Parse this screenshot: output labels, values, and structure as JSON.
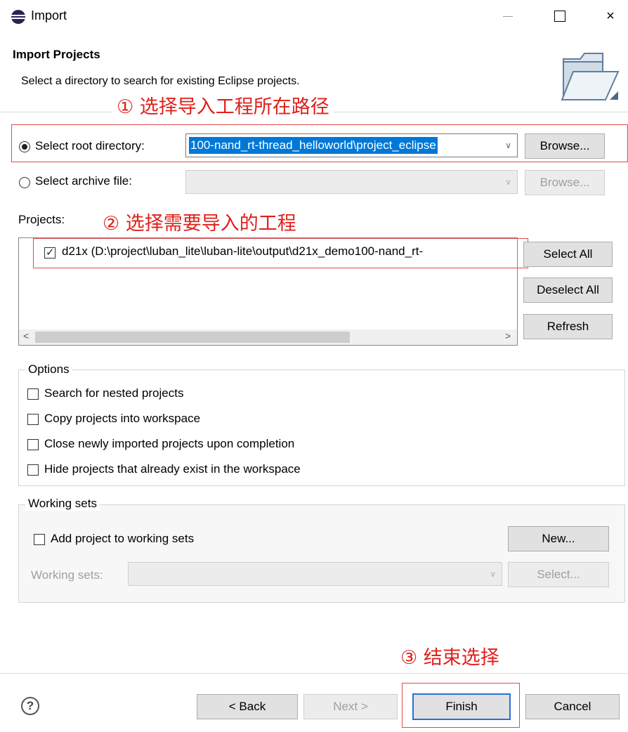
{
  "window": {
    "title": "Import",
    "minimize_icon": "minimize-icon",
    "maximize_icon": "maximize-icon",
    "close_glyph": "×"
  },
  "banner": {
    "title": "Import Projects",
    "subtitle": "Select a directory to search for existing Eclipse projects."
  },
  "annotations": {
    "step1": "① 选择导入工程所在路径",
    "step2": "② 选择需要导入的工程",
    "step3": "③ 结束选择",
    "color": "#e0201b"
  },
  "source": {
    "root_label": "Select root directory:",
    "root_value": "100-nand_rt-thread_helloworld\\project_eclipse",
    "root_selected": true,
    "archive_label": "Select archive file:",
    "archive_value": "",
    "browse_label": "Browse...",
    "browse_archive_label": "Browse..."
  },
  "projects": {
    "label": "Projects:",
    "items": [
      {
        "label": "d21x (D:\\project\\luban_lite\\luban-lite\\output\\d21x_demo100-nand_rt-",
        "checked": true
      }
    ],
    "select_all": "Select All",
    "deselect_all": "Deselect All",
    "refresh": "Refresh",
    "scroll_left": "<",
    "scroll_right": ">"
  },
  "options": {
    "title": "Options",
    "items": [
      {
        "label": "Search for nested projects",
        "checked": false
      },
      {
        "label": "Copy projects into workspace",
        "checked": false
      },
      {
        "label": "Close newly imported projects upon completion",
        "checked": false
      },
      {
        "label": "Hide projects that already exist in the workspace",
        "checked": false
      }
    ]
  },
  "working_sets": {
    "title": "Working sets",
    "add_label": "Add project to working sets",
    "add_checked": false,
    "sets_label": "Working sets:",
    "sets_value": "",
    "new_button": "New...",
    "select_button": "Select..."
  },
  "footer": {
    "help_glyph": "?",
    "back": "< Back",
    "next": "Next >",
    "finish": "Finish",
    "cancel": "Cancel"
  },
  "colors": {
    "accent": "#2a6fd4",
    "selection": "#0078d7",
    "annotation": "#e0201b"
  }
}
